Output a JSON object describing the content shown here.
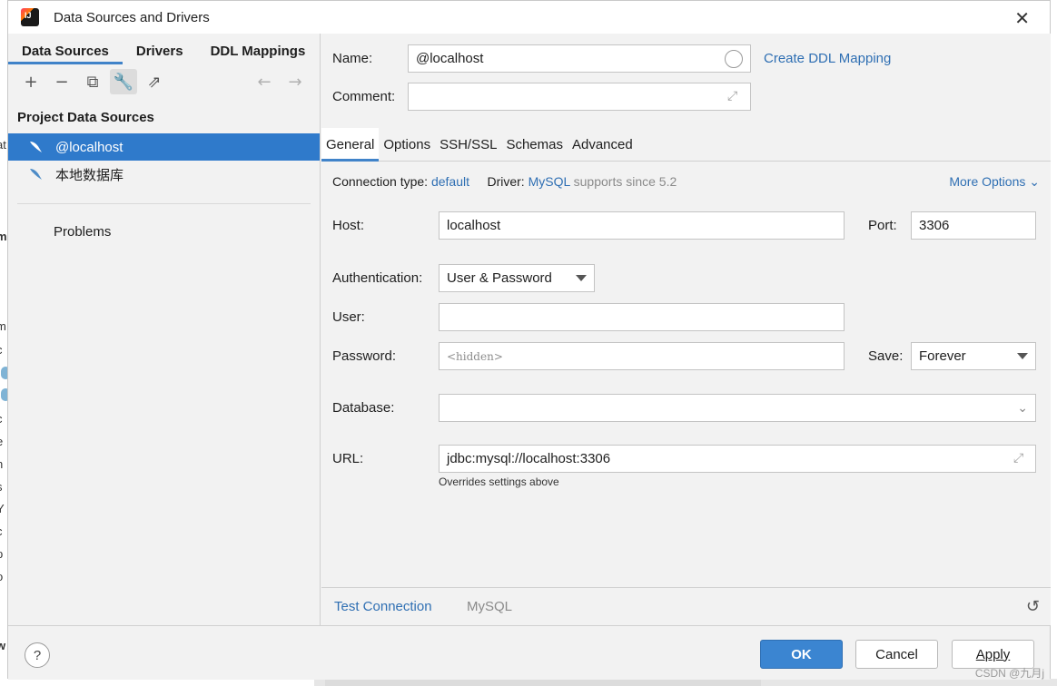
{
  "window": {
    "title": "Data Sources and Drivers",
    "close_glyph": "✕"
  },
  "left": {
    "tabs": [
      {
        "label": "Data Sources",
        "active": true
      },
      {
        "label": "Drivers",
        "active": false
      },
      {
        "label": "DDL Mappings",
        "active": false
      }
    ],
    "toolbar": {
      "add": "+",
      "remove": "−",
      "duplicate": "⧉",
      "properties": "🔧",
      "export": "⇗",
      "back": "←",
      "forward": "→"
    },
    "group_title": "Project Data Sources",
    "items": [
      {
        "label": "@localhost",
        "selected": true,
        "icon": "mysql-dolphin-icon"
      },
      {
        "label": "本地数据库",
        "selected": false,
        "icon": "mysql-dolphin-icon"
      }
    ],
    "problems_label": "Problems"
  },
  "form": {
    "name_label": "Name:",
    "name_value": "@localhost",
    "create_ddl_link": "Create DDL Mapping",
    "comment_label": "Comment:",
    "comment_value": "",
    "tabs": [
      {
        "label": "General",
        "active": true
      },
      {
        "label": "Options",
        "active": false
      },
      {
        "label": "SSH/SSL",
        "active": false
      },
      {
        "label": "Schemas",
        "active": false
      },
      {
        "label": "Advanced",
        "active": false
      }
    ],
    "connection_type_label": "Connection type:",
    "connection_type_value": "default",
    "driver_label": "Driver:",
    "driver_value": "MySQL",
    "driver_note": "supports since 5.2",
    "more_options": "More Options",
    "host_label": "Host:",
    "host_value": "localhost",
    "port_label": "Port:",
    "port_value": "3306",
    "auth_label": "Authentication:",
    "auth_value": "User & Password",
    "user_label": "User:",
    "user_value": "",
    "password_label": "Password:",
    "password_placeholder": "<hidden>",
    "save_label": "Save:",
    "save_value": "Forever",
    "database_label": "Database:",
    "database_value": "",
    "url_label": "URL:",
    "url_value": "jdbc:mysql://localhost:3306",
    "url_note": "Overrides settings above",
    "test_connection": "Test Connection",
    "driver_footer": "MySQL"
  },
  "footer": {
    "help": "?",
    "ok": "OK",
    "cancel": "Cancel",
    "apply": "Apply",
    "watermark": "CSDN @九月j"
  },
  "background_fragments": [
    "at",
    "m",
    "m",
    "c",
    "c",
    "e",
    "n",
    "s",
    "Y",
    "c",
    "p",
    "o",
    "w"
  ],
  "colors": {
    "accent": "#4083c9",
    "selection": "#2f7acb",
    "link": "#2f6fb3",
    "primary_button": "#3b85d1"
  }
}
